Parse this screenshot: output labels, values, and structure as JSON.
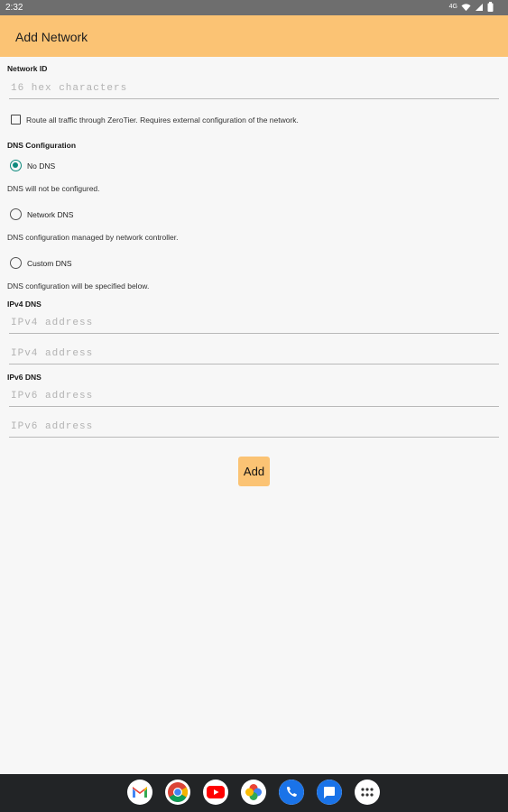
{
  "status_bar": {
    "time": "2:32",
    "network": "4G"
  },
  "app_bar": {
    "title": "Add Network"
  },
  "network_id": {
    "label": "Network ID",
    "placeholder": "16 hex characters"
  },
  "route_all": {
    "label": "Route all traffic through ZeroTier. Requires external configuration of the network.",
    "checked": false
  },
  "dns": {
    "heading": "DNS Configuration",
    "options": [
      {
        "label": "No DNS",
        "description": "DNS will not be configured.",
        "selected": true
      },
      {
        "label": "Network DNS",
        "description": "DNS configuration managed by network controller.",
        "selected": false
      },
      {
        "label": "Custom DNS",
        "description": "DNS configuration will be specified below.",
        "selected": false
      }
    ]
  },
  "ipv4": {
    "label": "IPv4 DNS",
    "fields": [
      {
        "placeholder": "IPv4 address"
      },
      {
        "placeholder": "IPv4 address"
      }
    ]
  },
  "ipv6": {
    "label": "IPv6 DNS",
    "fields": [
      {
        "placeholder": "IPv6 address"
      },
      {
        "placeholder": "IPv6 address"
      }
    ]
  },
  "add_button": {
    "label": "Add"
  },
  "colors": {
    "accent": "#fbc374",
    "radio_selected": "#0e8a7d",
    "status_bar": "#6e6e6e",
    "nav_bar": "#222426"
  },
  "dock": {
    "icons": [
      "gmail-icon",
      "chrome-icon",
      "youtube-icon",
      "photos-icon",
      "phone-icon",
      "messages-icon",
      "app-drawer-icon"
    ]
  }
}
